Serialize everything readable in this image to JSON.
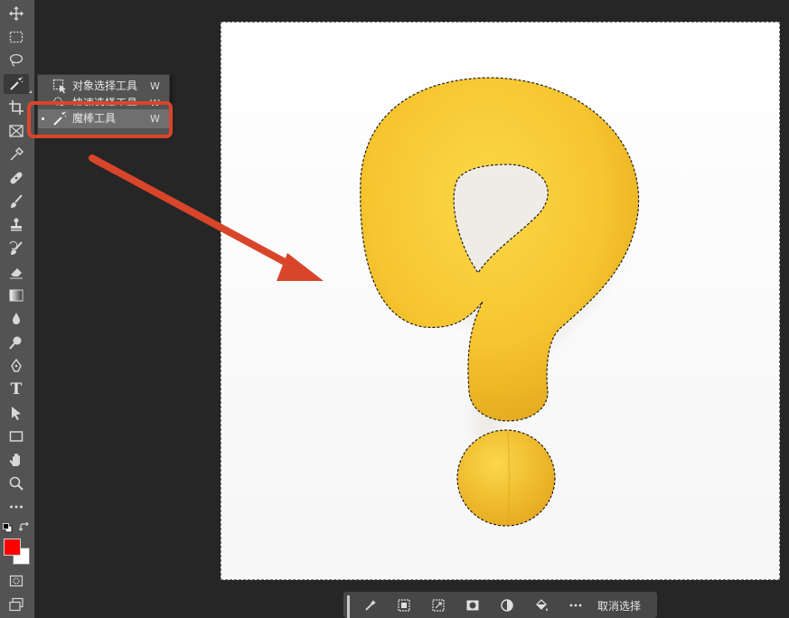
{
  "toolbar": {
    "tools": [
      {
        "name": "move-icon"
      },
      {
        "name": "marquee-icon"
      },
      {
        "name": "lasso-icon"
      },
      {
        "name": "magic-wand-icon",
        "active": true
      },
      {
        "name": "crop-icon"
      },
      {
        "name": "frame-icon"
      },
      {
        "name": "eyedropper-icon"
      },
      {
        "name": "healing-brush-icon"
      },
      {
        "name": "brush-icon"
      },
      {
        "name": "clone-stamp-icon"
      },
      {
        "name": "history-brush-icon"
      },
      {
        "name": "eraser-icon"
      },
      {
        "name": "gradient-icon"
      },
      {
        "name": "blur-icon"
      },
      {
        "name": "dodge-icon"
      },
      {
        "name": "pen-icon"
      },
      {
        "name": "type-icon"
      },
      {
        "name": "path-selection-icon"
      },
      {
        "name": "rectangle-icon"
      },
      {
        "name": "hand-icon"
      },
      {
        "name": "zoom-icon"
      },
      {
        "name": "more-tools-icon"
      }
    ],
    "type_glyph": "T",
    "foreground_color": "#ff0000",
    "background_color": "#ffffff"
  },
  "flyout": {
    "items": [
      {
        "label": "对象选择工具",
        "shortcut": "W",
        "icon": "object-selection-icon"
      },
      {
        "label": "快速选择工具",
        "shortcut": "W",
        "icon": "quick-selection-icon"
      },
      {
        "label": "魔棒工具",
        "shortcut": "W",
        "icon": "magic-wand-icon",
        "selected": true
      }
    ],
    "highlight_color": "#d9452a"
  },
  "canvas": {
    "subject_color": "#f5c531",
    "background": "#ffffff"
  },
  "taskbar": {
    "buttons": [
      "select-subject-icon",
      "select-mask-icon",
      "transform-selection-icon",
      "mask-icon",
      "fill-icon",
      "paint-bucket-icon",
      "more-icon"
    ],
    "deselect_label": "取消选择"
  }
}
